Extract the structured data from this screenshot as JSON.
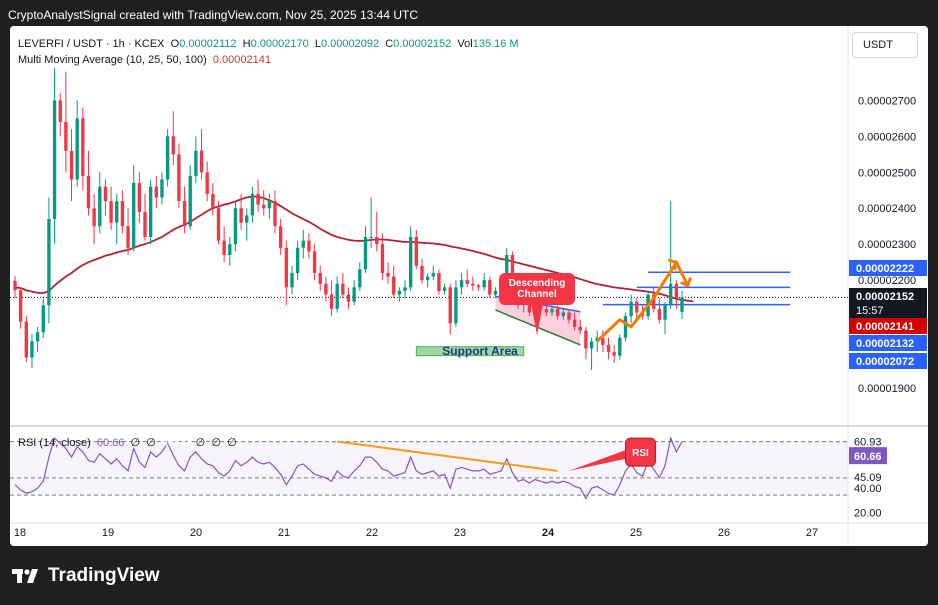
{
  "header": {
    "caption": "CryptoAnalystSignal created with TradingView.com, Nov 25, 2025 13:44 UTC"
  },
  "symbol": {
    "name": "LEVERFI / USDT · 1h · KCEX",
    "o_label": "O",
    "o": "0.00002112",
    "h_label": "H",
    "h": "0.00002170",
    "l_label": "L",
    "l": "0.00002092",
    "c_label": "C",
    "c": "0.00002152",
    "vol_label": "Vol",
    "vol": "135.16 M"
  },
  "indicator": {
    "name": "Multi Moving Average (10, 25, 50, 100)",
    "value": "0.00002141"
  },
  "currency_button": "USDT",
  "rsi": {
    "name": "RSI (14, close)",
    "value": "60.66",
    "n1": "∅",
    "n2": "∅",
    "ma_value": "45.09",
    "n3": "∅",
    "n4": "∅",
    "n5": "∅"
  },
  "annotations": {
    "descending_channel": "Descending Channel",
    "support_area": "Support Area",
    "rsi_tag": "RSI",
    "countdown": "15:57"
  },
  "logo": {
    "text": "TradingView"
  },
  "chart_data": {
    "type": "candlestick",
    "price_axis": {
      "ticks": [
        "0.00002700",
        "0.00002600",
        "0.00002500",
        "0.00002400",
        "0.00002300",
        "0.00002200",
        "0.00001900"
      ],
      "tick_values": [
        2.7e-05,
        2.6e-05,
        2.5e-05,
        2.4e-05,
        2.3e-05,
        2.2e-05,
        1.9e-05
      ],
      "ylim": [
        1.85e-05,
        2.79e-05
      ]
    },
    "time_axis": {
      "labels": [
        "18",
        "19",
        "20",
        "21",
        "22",
        "23",
        "24",
        "25",
        "26",
        "27"
      ],
      "bold": [
        "24"
      ]
    },
    "price_labels": [
      {
        "value": "0.00002222",
        "style": "blue"
      },
      {
        "value": "0.00002152",
        "style": "dark"
      },
      {
        "value": "0.00002141",
        "style": "red"
      },
      {
        "value": "0.00002132",
        "style": "blue"
      },
      {
        "value": "0.00002072",
        "style": "blue"
      }
    ],
    "rsi_axis": {
      "ticks": [
        "60.93",
        "60.66",
        "45.09",
        "40.00",
        "20.00"
      ],
      "ylim": [
        15,
        70
      ],
      "band_upper": 60.93,
      "band_mid": 40,
      "band_lower": 30
    },
    "candles": [
      [
        2.198e-05,
        2.212e-05,
        2.15e-05,
        2.172e-05
      ],
      [
        2.172e-05,
        2.18e-05,
        2.065e-05,
        2.085e-05
      ],
      [
        2.085e-05,
        2.1e-05,
        1.972e-05,
        1.985e-05
      ],
      [
        1.985e-05,
        2.05e-05,
        1.955e-05,
        2.03e-05
      ],
      [
        2.03e-05,
        2.07e-05,
        2e-05,
        2.055e-05
      ],
      [
        2.055e-05,
        2.15e-05,
        2.04e-05,
        2.13e-05
      ],
      [
        2.13e-05,
        2.43e-05,
        2.08e-05,
        2.37e-05
      ],
      [
        2.37e-05,
        2.79e-05,
        2.3e-05,
        2.7e-05
      ],
      [
        2.7e-05,
        2.72e-05,
        2.6e-05,
        2.64e-05
      ],
      [
        2.64e-05,
        2.78e-05,
        2.5e-05,
        2.56e-05
      ],
      [
        2.56e-05,
        2.62e-05,
        2.42e-05,
        2.48e-05
      ],
      [
        2.48e-05,
        2.7e-05,
        2.46e-05,
        2.65e-05
      ],
      [
        2.65e-05,
        2.68e-05,
        2.45e-05,
        2.49e-05
      ],
      [
        2.49e-05,
        2.56e-05,
        2.38e-05,
        2.4e-05
      ],
      [
        2.4e-05,
        2.44e-05,
        2.3e-05,
        2.35e-05
      ],
      [
        2.35e-05,
        2.5e-05,
        2.33e-05,
        2.46e-05
      ],
      [
        2.46e-05,
        2.48e-05,
        2.38e-05,
        2.42e-05
      ],
      [
        2.42e-05,
        2.46e-05,
        2.34e-05,
        2.36e-05
      ],
      [
        2.36e-05,
        2.44e-05,
        2.3e-05,
        2.42e-05
      ],
      [
        2.42e-05,
        2.45e-05,
        2.33e-05,
        2.35e-05
      ],
      [
        2.35e-05,
        2.4e-05,
        2.27e-05,
        2.29e-05
      ],
      [
        2.29e-05,
        2.52e-05,
        2.28e-05,
        2.47e-05
      ],
      [
        2.47e-05,
        2.5e-05,
        2.36e-05,
        2.39e-05
      ],
      [
        2.39e-05,
        2.44e-05,
        2.31e-05,
        2.32e-05
      ],
      [
        2.32e-05,
        2.48e-05,
        2.3e-05,
        2.46e-05
      ],
      [
        2.46e-05,
        2.49e-05,
        2.4e-05,
        2.43e-05
      ],
      [
        2.43e-05,
        2.5e-05,
        2.41e-05,
        2.48e-05
      ],
      [
        2.48e-05,
        2.62e-05,
        2.46e-05,
        2.6e-05
      ],
      [
        2.6e-05,
        2.67e-05,
        2.52e-05,
        2.55e-05
      ],
      [
        2.55e-05,
        2.58e-05,
        2.4e-05,
        2.42e-05
      ],
      [
        2.42e-05,
        2.46e-05,
        2.33e-05,
        2.35e-05
      ],
      [
        2.35e-05,
        2.52e-05,
        2.34e-05,
        2.49e-05
      ],
      [
        2.49e-05,
        2.6e-05,
        2.47e-05,
        2.56e-05
      ],
      [
        2.56e-05,
        2.62e-05,
        2.48e-05,
        2.5e-05
      ],
      [
        2.5e-05,
        2.53e-05,
        2.42e-05,
        2.44e-05
      ],
      [
        2.44e-05,
        2.47e-05,
        2.38e-05,
        2.4e-05
      ],
      [
        2.4e-05,
        2.42e-05,
        2.3e-05,
        2.31e-05
      ],
      [
        2.31e-05,
        2.35e-05,
        2.25e-05,
        2.27e-05
      ],
      [
        2.27e-05,
        2.32e-05,
        2.24e-05,
        2.3e-05
      ],
      [
        2.3e-05,
        2.42e-05,
        2.28e-05,
        2.4e-05
      ],
      [
        2.4e-05,
        2.44e-05,
        2.34e-05,
        2.36e-05
      ],
      [
        2.36e-05,
        2.4e-05,
        2.31e-05,
        2.38e-05
      ],
      [
        2.38e-05,
        2.46e-05,
        2.36e-05,
        2.44e-05
      ],
      [
        2.44e-05,
        2.48e-05,
        2.39e-05,
        2.41e-05
      ],
      [
        2.41e-05,
        2.45e-05,
        2.38e-05,
        2.4e-05
      ],
      [
        2.4e-05,
        2.44e-05,
        2.37e-05,
        2.42e-05
      ],
      [
        2.42e-05,
        2.45e-05,
        2.33e-05,
        2.35e-05
      ],
      [
        2.35e-05,
        2.37e-05,
        2.27e-05,
        2.29e-05
      ],
      [
        2.29e-05,
        2.31e-05,
        2.13e-05,
        2.18e-05
      ],
      [
        2.18e-05,
        2.24e-05,
        2.16e-05,
        2.22e-05
      ],
      [
        2.22e-05,
        2.31e-05,
        2.2e-05,
        2.29e-05
      ],
      [
        2.29e-05,
        2.34e-05,
        2.26e-05,
        2.31e-05
      ],
      [
        2.31e-05,
        2.33e-05,
        2.26e-05,
        2.28e-05
      ],
      [
        2.28e-05,
        2.3e-05,
        2.2e-05,
        2.22e-05
      ],
      [
        2.22e-05,
        2.24e-05,
        2.17e-05,
        2.19e-05
      ],
      [
        2.19e-05,
        2.21e-05,
        2.14e-05,
        2.16e-05
      ],
      [
        2.16e-05,
        2.2e-05,
        2.1e-05,
        2.12e-05
      ],
      [
        2.12e-05,
        2.21e-05,
        2.11e-05,
        2.19e-05
      ],
      [
        2.19e-05,
        2.22e-05,
        2.15e-05,
        2.16e-05
      ],
      [
        2.16e-05,
        2.18e-05,
        2.12e-05,
        2.14e-05
      ],
      [
        2.14e-05,
        2.2e-05,
        2.13e-05,
        2.18e-05
      ],
      [
        2.18e-05,
        2.25e-05,
        2.17e-05,
        2.23e-05
      ],
      [
        2.23e-05,
        2.35e-05,
        2.22e-05,
        2.32e-05
      ],
      [
        2.32e-05,
        2.43e-05,
        2.29e-05,
        2.32e-05
      ],
      [
        2.32e-05,
        2.39e-05,
        2.28e-05,
        2.3e-05
      ],
      [
        2.3e-05,
        2.33e-05,
        2.2e-05,
        2.22e-05
      ],
      [
        2.22e-05,
        2.25e-05,
        2.19e-05,
        2.21e-05
      ],
      [
        2.21e-05,
        2.24e-05,
        2.15e-05,
        2.16e-05
      ],
      [
        2.16e-05,
        2.18e-05,
        2.14e-05,
        2.17e-05
      ],
      [
        2.17e-05,
        2.2e-05,
        2.15e-05,
        2.18e-05
      ],
      [
        2.18e-05,
        2.35e-05,
        2.17e-05,
        2.32e-05
      ],
      [
        2.32e-05,
        2.34e-05,
        2.23e-05,
        2.24e-05
      ],
      [
        2.24e-05,
        2.26e-05,
        2.19e-05,
        2.2e-05
      ],
      [
        2.2e-05,
        2.22e-05,
        2.18e-05,
        2.21e-05
      ],
      [
        2.21e-05,
        2.24e-05,
        2.2e-05,
        2.22e-05
      ],
      [
        2.22e-05,
        2.23e-05,
        2.16e-05,
        2.17e-05
      ],
      [
        2.17e-05,
        2.19e-05,
        2.16e-05,
        2.18e-05
      ],
      [
        2.18e-05,
        2.19e-05,
        2.05e-05,
        2.08e-05
      ],
      [
        2.08e-05,
        2.2e-05,
        2.07e-05,
        2.18e-05
      ],
      [
        2.18e-05,
        2.22e-05,
        2.16e-05,
        2.2e-05
      ],
      [
        2.2e-05,
        2.23e-05,
        2.18e-05,
        2.19e-05
      ],
      [
        2.19e-05,
        2.21e-05,
        2.17e-05,
        2.185e-05
      ],
      [
        2.185e-05,
        2.19e-05,
        2.17e-05,
        2.18e-05
      ],
      [
        2.18e-05,
        2.22e-05,
        2.17e-05,
        2.2e-05
      ],
      [
        2.2e-05,
        2.21e-05,
        2.15e-05,
        2.16e-05
      ],
      [
        2.16e-05,
        2.18e-05,
        2.15e-05,
        2.17e-05
      ],
      [
        2.17e-05,
        2.2e-05,
        2.16e-05,
        2.19e-05
      ],
      [
        2.19e-05,
        2.29e-05,
        2.18e-05,
        2.27e-05
      ],
      [
        2.27e-05,
        2.28e-05,
        2.18e-05,
        2.19e-05
      ],
      [
        2.19e-05,
        2.2e-05,
        2.12e-05,
        2.13e-05
      ],
      [
        2.13e-05,
        2.15e-05,
        2.11e-05,
        2.14e-05
      ],
      [
        2.14e-05,
        2.15e-05,
        2.1e-05,
        2.11e-05
      ],
      [
        2.11e-05,
        2.14e-05,
        2.1e-05,
        2.13e-05
      ],
      [
        2.13e-05,
        2.14e-05,
        2.11e-05,
        2.12e-05
      ],
      [
        2.12e-05,
        2.13e-05,
        2.1e-05,
        2.11e-05
      ],
      [
        2.11e-05,
        2.13e-05,
        2.1e-05,
        2.12e-05
      ],
      [
        2.12e-05,
        2.13e-05,
        2.09e-05,
        2.1e-05
      ],
      [
        2.1e-05,
        2.12e-05,
        2.09e-05,
        2.11e-05
      ],
      [
        2.11e-05,
        2.12e-05,
        2.08e-05,
        2.09e-05
      ],
      [
        2.09e-05,
        2.11e-05,
        2.06e-05,
        2.07e-05
      ],
      [
        2.07e-05,
        2.09e-05,
        2.05e-05,
        2.06e-05
      ],
      [
        2.06e-05,
        2.07e-05,
        1.98e-05,
        2.01e-05
      ],
      [
        2.01e-05,
        2.04e-05,
        1.95e-05,
        2.03e-05
      ],
      [
        2.03e-05,
        2.06e-05,
        2e-05,
        2.04e-05
      ],
      [
        2.04e-05,
        2.06e-05,
        2e-05,
        2.02e-05
      ],
      [
        2.02e-05,
        2.04e-05,
        1.98e-05,
        2e-05
      ],
      [
        2e-05,
        2.02e-05,
        1.97e-05,
        1.99e-05
      ],
      [
        1.99e-05,
        2.05e-05,
        1.98e-05,
        2.04e-05
      ],
      [
        2.04e-05,
        2.11e-05,
        2.03e-05,
        2.1e-05
      ],
      [
        2.1e-05,
        2.16e-05,
        2.08e-05,
        2.14e-05
      ],
      [
        2.14e-05,
        2.15e-05,
        2.09e-05,
        2.11e-05
      ],
      [
        2.11e-05,
        2.13e-05,
        2.09e-05,
        2.1e-05
      ],
      [
        2.1e-05,
        2.17e-05,
        2.09e-05,
        2.16e-05
      ],
      [
        2.16e-05,
        2.18e-05,
        2.11e-05,
        2.12e-05
      ],
      [
        2.12e-05,
        2.15e-05,
        2.08e-05,
        2.09e-05
      ],
      [
        2.09e-05,
        2.14e-05,
        2.05e-05,
        2.13e-05
      ],
      [
        2.13e-05,
        2.42e-05,
        2.12e-05,
        2.19e-05
      ],
      [
        2.19e-05,
        2.2e-05,
        2.12e-05,
        2.15e-05
      ],
      [
        2.112e-05,
        2.17e-05,
        2.092e-05,
        2.152e-05
      ]
    ],
    "moving_average": [
      2.18e-05,
      2.178e-05,
      2.172e-05,
      2.168e-05,
      2.165e-05,
      2.164e-05,
      2.17e-05,
      2.185e-05,
      2.198e-05,
      2.21e-05,
      2.22e-05,
      2.232e-05,
      2.242e-05,
      2.25e-05,
      2.256e-05,
      2.262e-05,
      2.268e-05,
      2.272e-05,
      2.277e-05,
      2.281e-05,
      2.284e-05,
      2.29e-05,
      2.296e-05,
      2.3e-05,
      2.306e-05,
      2.313e-05,
      2.32e-05,
      2.33e-05,
      2.34e-05,
      2.348e-05,
      2.354e-05,
      2.362e-05,
      2.372e-05,
      2.382e-05,
      2.392e-05,
      2.4e-05,
      2.405e-05,
      2.41e-05,
      2.414e-05,
      2.419e-05,
      2.425e-05,
      2.43e-05,
      2.433e-05,
      2.432e-05,
      2.428e-05,
      2.422e-05,
      2.415e-05,
      2.406e-05,
      2.396e-05,
      2.386e-05,
      2.378e-05,
      2.37e-05,
      2.362e-05,
      2.353e-05,
      2.343e-05,
      2.334e-05,
      2.326e-05,
      2.32e-05,
      2.316e-05,
      2.312e-05,
      2.31e-05,
      2.309e-05,
      2.31e-05,
      2.312e-05,
      2.313e-05,
      2.313e-05,
      2.312e-05,
      2.31e-05,
      2.308e-05,
      2.306e-05,
      2.306e-05,
      2.305e-05,
      2.304e-05,
      2.303e-05,
      2.302e-05,
      2.3e-05,
      2.298e-05,
      2.294e-05,
      2.291e-05,
      2.288e-05,
      2.285e-05,
      2.281e-05,
      2.277e-05,
      2.273e-05,
      2.268e-05,
      2.263e-05,
      2.259e-05,
      2.256e-05,
      2.252e-05,
      2.248e-05,
      2.244e-05,
      2.24e-05,
      2.236e-05,
      2.232e-05,
      2.228e-05,
      2.224e-05,
      2.22e-05,
      2.216e-05,
      2.212e-05,
      2.208e-05,
      2.203e-05,
      2.198e-05,
      2.193e-05,
      2.189e-05,
      2.186e-05,
      2.183e-05,
      2.18e-05,
      2.178e-05,
      2.176e-05,
      2.174e-05,
      2.172e-05,
      2.17e-05,
      2.168e-05,
      2.165e-05,
      2.162e-05,
      2.158e-05,
      2.153e-05,
      2.148e-05,
      2.145e-05,
      2.143e-05,
      2.141e-05
    ],
    "rsi_values": [
      36,
      33,
      31,
      32,
      34,
      38,
      52,
      63,
      60,
      57,
      52,
      58,
      55,
      50,
      49,
      54,
      51,
      48,
      51,
      47,
      44,
      57,
      49,
      46,
      55,
      52,
      55,
      60,
      53,
      47,
      44,
      52,
      55,
      51,
      48,
      47,
      43,
      41,
      44,
      50,
      47,
      49,
      52,
      49,
      48,
      49,
      46,
      42,
      36,
      41,
      47,
      48,
      45,
      42,
      41,
      40,
      38,
      44,
      41,
      40,
      44,
      47,
      52,
      52,
      49,
      45,
      44,
      41,
      42,
      43,
      52,
      44,
      42,
      43,
      44,
      41,
      42,
      34,
      45,
      46,
      45,
      44,
      44,
      45,
      42,
      43,
      44,
      51,
      43,
      38,
      39,
      37,
      39,
      38,
      37,
      38,
      37,
      38,
      37,
      35,
      34,
      28,
      34,
      35,
      33,
      31,
      30,
      36,
      44,
      48,
      43,
      41,
      49,
      45,
      40,
      47,
      63,
      55,
      61
    ],
    "drawings": {
      "channel_top": [
        [
          2.155e-05,
          85
        ],
        [
          2.112e-05,
          100
        ]
      ],
      "channel_bottom": [
        [
          2.117e-05,
          85
        ],
        [
          2.02e-05,
          100
        ]
      ],
      "support_band": [
        2.015e-05,
        1.99e-05
      ],
      "support_band_range": [
        71,
        90
      ],
      "upper_line": {
        "price": 2.222e-05,
        "from": 112,
        "to": 123
      },
      "mid_line": {
        "price": 2.18e-05,
        "from": 110,
        "to": 123
      },
      "lower_line": {
        "price": 2.132e-05,
        "from": 104,
        "to": 123
      },
      "arrow_path": [
        [
          103,
          2.03e-05
        ],
        [
          107,
          2.09e-05
        ],
        [
          109,
          2.07e-05
        ],
        [
          113,
          2.15e-05
        ],
        [
          117,
          2.25e-05
        ],
        [
          119,
          2.185e-05
        ]
      ],
      "rsi_trend": [
        [
          57,
          61
        ],
        [
          96,
          44
        ]
      ]
    }
  }
}
